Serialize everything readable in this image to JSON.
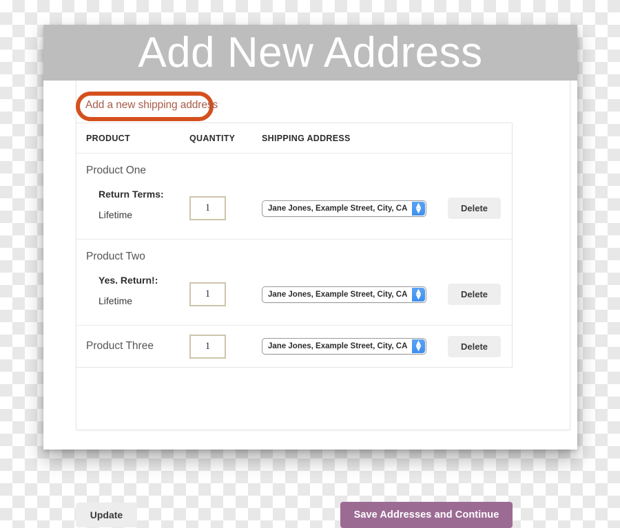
{
  "window": {
    "banner_title": "Add New Address"
  },
  "annotation": {
    "link_label": "Add a new shipping address",
    "highlight_color": "#d4501e",
    "link_color": "#a75b47"
  },
  "table": {
    "columns": [
      {
        "key": "product",
        "label": "PRODUCT"
      },
      {
        "key": "quantity",
        "label": "QUANTITY"
      },
      {
        "key": "shipping_address",
        "label": "SHIPPING ADDRESS"
      },
      {
        "key": "action",
        "label": ""
      }
    ],
    "rows": [
      {
        "product": "Product One",
        "detail_label": "Return Terms:",
        "detail_value": "Lifetime",
        "quantity": "1",
        "shipping_address": "Jane Jones, Example Street, City, CA",
        "delete_label": "Delete"
      },
      {
        "product": "Product Two",
        "detail_label": "Yes. Return!:",
        "detail_value": "Lifetime",
        "quantity": "1",
        "shipping_address": "Jane Jones, Example Street, City, CA",
        "delete_label": "Delete"
      },
      {
        "product": "Product Three",
        "detail_label": "",
        "detail_value": "",
        "quantity": "1",
        "shipping_address": "Jane Jones, Example Street, City, CA",
        "delete_label": "Delete"
      }
    ]
  },
  "footer": {
    "update_label": "Update",
    "save_label": "Save Addresses and Continue",
    "save_color": "#9c6b94"
  },
  "icons": {
    "stepper_up": "▴",
    "stepper_down": "▾"
  }
}
